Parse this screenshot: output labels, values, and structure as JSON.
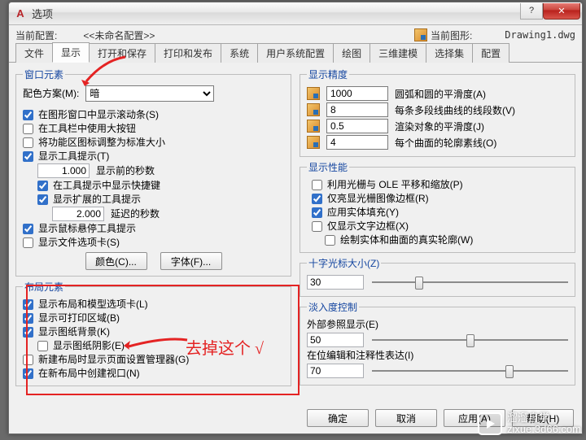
{
  "title": "选项",
  "toprow": {
    "current_profile_label": "当前配置:",
    "current_profile_value": "<<未命名配置>>",
    "current_drawing_label": "当前图形:",
    "current_drawing_value": "Drawing1.dwg"
  },
  "tabs": [
    "文件",
    "显示",
    "打开和保存",
    "打印和发布",
    "系统",
    "用户系统配置",
    "绘图",
    "三维建模",
    "选择集",
    "配置"
  ],
  "active_tab": "显示",
  "left": {
    "window_group": "窗口元素",
    "scheme_label": "配色方案(M):",
    "scheme_value": "暗",
    "chk_scroll": "在图形窗口中显示滚动条(S)",
    "chk_bigbtn": "在工具栏中使用大按钮",
    "chk_stdicon": "将功能区图标调整为标准大小",
    "chk_tooltips": "显示工具提示(T)",
    "sec_before": "1.000",
    "sec_before_lbl": "显示前的秒数",
    "chk_shortcut": "在工具提示中显示快捷键",
    "chk_ext_tt": "显示扩展的工具提示",
    "delay_sec": "2.000",
    "delay_sec_lbl": "延迟的秒数",
    "chk_hover": "显示鼠标悬停工具提示",
    "chk_filetabs": "显示文件选项卡(S)",
    "btn_color": "颜色(C)...",
    "btn_font": "字体(F)...",
    "layout_group": "布局元素",
    "chk_layouttabs": "显示布局和模型选项卡(L)",
    "chk_printable": "显示可打印区域(B)",
    "chk_paperbg": "显示图纸背景(K)",
    "chk_papershadow": "显示图纸阴影(E)",
    "chk_pagesetup": "新建布局时显示页面设置管理器(G)",
    "chk_viewport": "在新布局中创建视口(N)"
  },
  "right": {
    "precision_group": "显示精度",
    "p1_val": "1000",
    "p1_lbl": "圆弧和圆的平滑度(A)",
    "p2_val": "8",
    "p2_lbl": "每条多段线曲线的线段数(V)",
    "p3_val": "0.5",
    "p3_lbl": "渲染对象的平滑度(J)",
    "p4_val": "4",
    "p4_lbl": "每个曲面的轮廓素线(O)",
    "perf_group": "显示性能",
    "chk_pan": "利用光栅与 OLE 平移和缩放(P)",
    "chk_frame": "仅亮显光栅图像边框(R)",
    "chk_solidfill": "应用实体填充(Y)",
    "chk_textframe": "仅显示文字边框(X)",
    "chk_silh": "绘制实体和曲面的真实轮廓(W)",
    "cross_group": "十字光标大小(Z)",
    "cross_val": "30",
    "fade_group": "淡入度控制",
    "fade_xref_lbl": "外部参照显示(E)",
    "fade_xref_val": "50",
    "fade_edit_lbl": "在位编辑和注释性表达(I)",
    "fade_edit_val": "70"
  },
  "footer": {
    "ok": "确定",
    "cancel": "取消",
    "apply": "应用(A)",
    "help": "帮助(H)"
  },
  "annotation": "去掉这个 √",
  "watermark": {
    "l1": "溜溜自学",
    "l2": "zixue.3d66.com"
  }
}
